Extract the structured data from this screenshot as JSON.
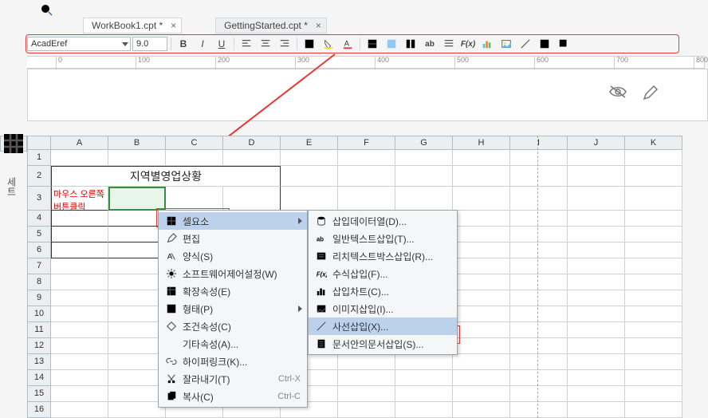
{
  "top_icons": {
    "zoom": "search-icon"
  },
  "tabs": [
    {
      "icon": "sheet-icon",
      "label": "WorkBook1.cpt *",
      "active": true
    },
    {
      "icon": "sheet-icon",
      "label": "GettingStarted.cpt *",
      "active": false
    }
  ],
  "toolbar": {
    "font_name": "AcadEref",
    "font_size": "9.0",
    "bold": "B",
    "italic": "I",
    "underline": "U",
    "fx": "F(x)",
    "ab": "ab"
  },
  "ruler_ticks": [
    "0",
    "100",
    "200",
    "300",
    "400",
    "500",
    "600",
    "700",
    "800"
  ],
  "columns": [
    "A",
    "B",
    "C",
    "D",
    "E",
    "F",
    "G",
    "H",
    "I",
    "J",
    "K"
  ],
  "row_numbers": [
    "1",
    "2",
    "3",
    "4",
    "5",
    "6",
    "7",
    "8",
    "9",
    "10",
    "11",
    "12",
    "13",
    "14",
    "15",
    "16"
  ],
  "sheet_side_label": "세트",
  "title_text": "지역별영업상황",
  "hint_line1": "마우스 오른쪽",
  "hint_line2": "버튼클릭",
  "context_menu": {
    "items": [
      {
        "icon": "grid-icon",
        "label": "셀요소",
        "has_sub": true,
        "hov": true
      },
      {
        "icon": "pencil-icon",
        "label": "편집"
      },
      {
        "icon": "style-icon",
        "label": "양식(S)"
      },
      {
        "icon": "gear-icon",
        "label": "소프트웨어제어설정(W)"
      },
      {
        "icon": "expand-icon",
        "label": "확장속성(E)"
      },
      {
        "icon": "shape-icon",
        "label": "형태(P)",
        "has_sub": true
      },
      {
        "icon": "cond-icon",
        "label": "조건속성(C)"
      },
      {
        "icon": "blank",
        "label": "기타속성(A)..."
      },
      {
        "icon": "link-icon",
        "label": "하이퍼링크(K)..."
      },
      {
        "icon": "cut-icon",
        "label": "잘라내기(T)",
        "shortcut": "Ctrl-X"
      },
      {
        "icon": "copy-icon",
        "label": "복사(C)",
        "shortcut": "Ctrl-C"
      }
    ]
  },
  "sub_menu": {
    "items": [
      {
        "icon": "db-icon",
        "label": "삽입데이터열(D)..."
      },
      {
        "icon": "ab-icon",
        "label": "일반텍스트삽입(T)..."
      },
      {
        "icon": "rt-icon",
        "label": "리치텍스트박스삽입(R)..."
      },
      {
        "icon": "fx-icon",
        "label": "수식삽입(F)..."
      },
      {
        "icon": "chart-icon",
        "label": "삽입차트(C)..."
      },
      {
        "icon": "img-icon",
        "label": "이미지삽입(I)..."
      },
      {
        "icon": "diag-icon",
        "label": "사선삽입(X)...",
        "hov": true
      },
      {
        "icon": "doc-icon",
        "label": "문서안의문서삽입(S)..."
      }
    ]
  }
}
